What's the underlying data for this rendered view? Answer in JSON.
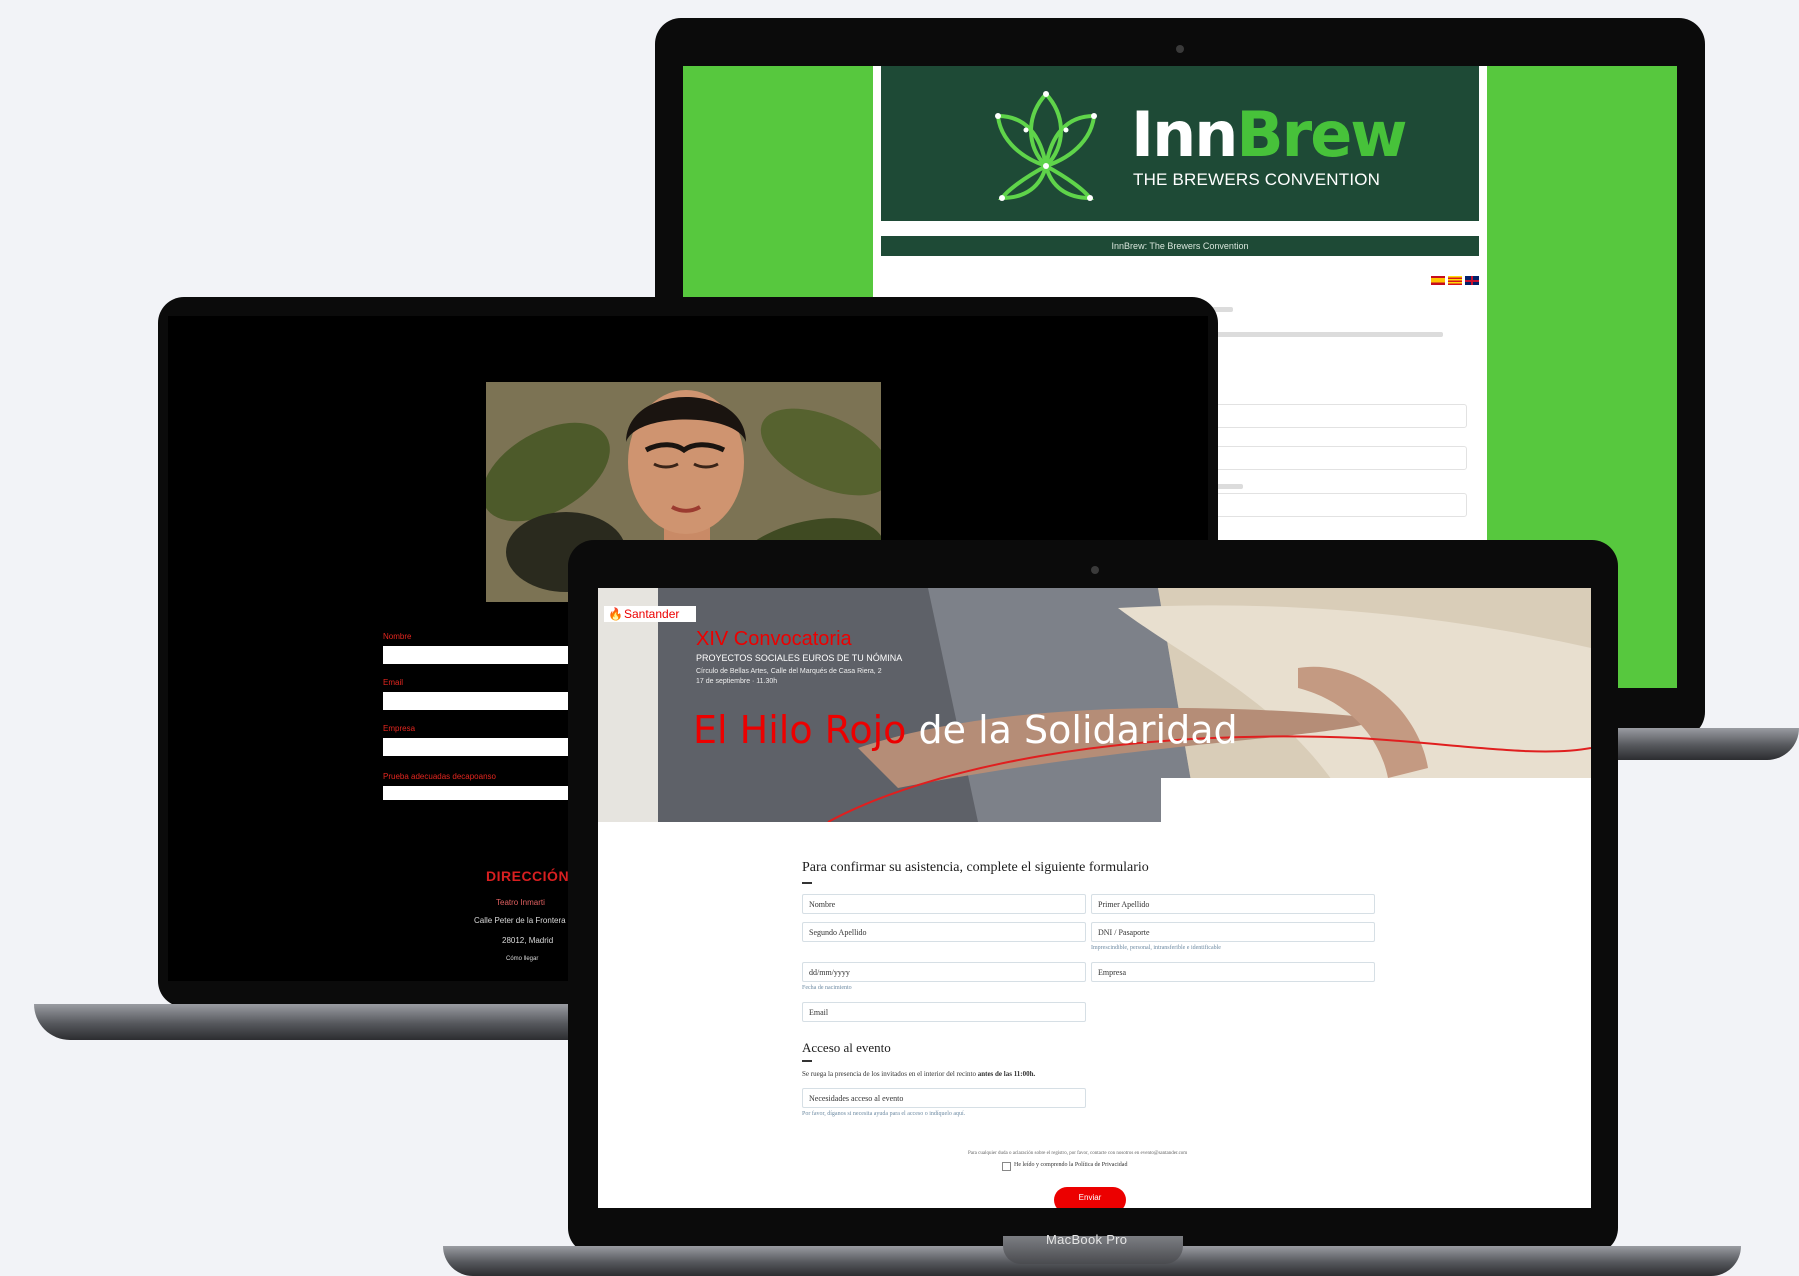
{
  "innbrew": {
    "logo_inn": "Inn",
    "logo_brew": "Brew",
    "logo_sub": "THE BREWERS CONVENTION",
    "title_bar": "InnBrew: The Brewers Convention",
    "flags": [
      "flag-es-icon",
      "flag-ca-icon",
      "flag-gb-icon"
    ],
    "colors": {
      "green_bg": "#57c83e",
      "dark_green": "#1e4a36",
      "brew_green": "#47c23a"
    }
  },
  "frida": {
    "fields": [
      {
        "label": "Nombre"
      },
      {
        "label": "Email"
      },
      {
        "label": "Empresa"
      },
      {
        "label": "Prueba adecuadas decapoanso"
      }
    ],
    "footer_title": "DIRECCIÓN",
    "footer_lines": [
      "Teatro Inmarti",
      "Calle Peter de la Frontera",
      "28012, Madrid",
      "Cómo llegar"
    ],
    "colors": {
      "accent": "#d81f20"
    }
  },
  "santander": {
    "brand": "Santander",
    "convocatoria": "XIV Convocatoria",
    "subtitle": "PROYECTOS SOCIALES EUROS DE TU NÓMINA",
    "venue": "Círculo de Bellas Artes, Calle del Marqués de Casa Riera, 2",
    "date": "17 de septiembre · 11.30h",
    "headline_red": "El Hilo Rojo",
    "headline_white": "de la Solidaridad",
    "form_title": "Para confirmar su asistencia, complete el siguiente formulario",
    "fields": {
      "nombre": "Nombre",
      "primer_apellido": "Primer Apellido",
      "segundo_apellido": "Segundo Apellido",
      "dni": "DNI / Pasaporte",
      "date": "dd/mm/yyyy",
      "empresa": "Empresa",
      "email": "Email",
      "necesidades": "Necesidades acceso al evento"
    },
    "notes": {
      "dni": "Imprescindible, personal, intransferible e identificable",
      "date": "Fecha de nacimiento",
      "necesidades": "Por favor, díganos si necesita ayuda para el acceso o indíquelo aquí."
    },
    "access_title": "Acceso al evento",
    "access_text": "Se ruega la presencia de los invitados en el interior del recinto",
    "access_bold": "antes de las 11:00h.",
    "privacy_note": "Para cualquier duda o aclaración sobre el registro, por favor, contacte con nosotros en evento@santander.com",
    "privacy_check": "He leído y comprendo la Política de Privacidad",
    "submit_label": "Enviar",
    "device_label": "MacBook Pro",
    "colors": {
      "red": "#ec0000"
    }
  }
}
